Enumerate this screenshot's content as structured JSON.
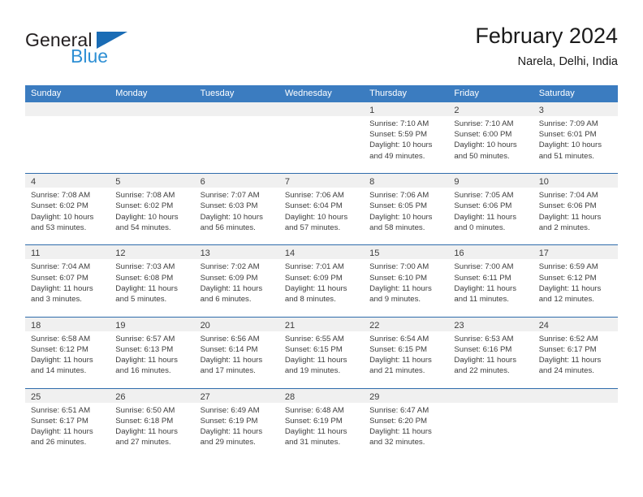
{
  "brand": {
    "name_part1": "General",
    "name_part2": "Blue",
    "flag_icon": "triangle-flag-icon",
    "color_dark": "#231f20",
    "color_blue": "#2e8fd4"
  },
  "header": {
    "title": "February 2024",
    "subtitle": "Narela, Delhi, India"
  },
  "theme": {
    "header_bg": "#3b7cc0",
    "row_border": "#2f6cab",
    "daynum_bg": "#f0f0f0",
    "text": "#3d3d3d"
  },
  "weekdays": [
    "Sunday",
    "Monday",
    "Tuesday",
    "Wednesday",
    "Thursday",
    "Friday",
    "Saturday"
  ],
  "weeks": [
    [
      {
        "day": "",
        "sunrise": "",
        "sunset": "",
        "daylight_line1": "",
        "daylight_line2": ""
      },
      {
        "day": "",
        "sunrise": "",
        "sunset": "",
        "daylight_line1": "",
        "daylight_line2": ""
      },
      {
        "day": "",
        "sunrise": "",
        "sunset": "",
        "daylight_line1": "",
        "daylight_line2": ""
      },
      {
        "day": "",
        "sunrise": "",
        "sunset": "",
        "daylight_line1": "",
        "daylight_line2": ""
      },
      {
        "day": "1",
        "sunrise": "Sunrise: 7:10 AM",
        "sunset": "Sunset: 5:59 PM",
        "daylight_line1": "Daylight: 10 hours",
        "daylight_line2": "and 49 minutes."
      },
      {
        "day": "2",
        "sunrise": "Sunrise: 7:10 AM",
        "sunset": "Sunset: 6:00 PM",
        "daylight_line1": "Daylight: 10 hours",
        "daylight_line2": "and 50 minutes."
      },
      {
        "day": "3",
        "sunrise": "Sunrise: 7:09 AM",
        "sunset": "Sunset: 6:01 PM",
        "daylight_line1": "Daylight: 10 hours",
        "daylight_line2": "and 51 minutes."
      }
    ],
    [
      {
        "day": "4",
        "sunrise": "Sunrise: 7:08 AM",
        "sunset": "Sunset: 6:02 PM",
        "daylight_line1": "Daylight: 10 hours",
        "daylight_line2": "and 53 minutes."
      },
      {
        "day": "5",
        "sunrise": "Sunrise: 7:08 AM",
        "sunset": "Sunset: 6:02 PM",
        "daylight_line1": "Daylight: 10 hours",
        "daylight_line2": "and 54 minutes."
      },
      {
        "day": "6",
        "sunrise": "Sunrise: 7:07 AM",
        "sunset": "Sunset: 6:03 PM",
        "daylight_line1": "Daylight: 10 hours",
        "daylight_line2": "and 56 minutes."
      },
      {
        "day": "7",
        "sunrise": "Sunrise: 7:06 AM",
        "sunset": "Sunset: 6:04 PM",
        "daylight_line1": "Daylight: 10 hours",
        "daylight_line2": "and 57 minutes."
      },
      {
        "day": "8",
        "sunrise": "Sunrise: 7:06 AM",
        "sunset": "Sunset: 6:05 PM",
        "daylight_line1": "Daylight: 10 hours",
        "daylight_line2": "and 58 minutes."
      },
      {
        "day": "9",
        "sunrise": "Sunrise: 7:05 AM",
        "sunset": "Sunset: 6:06 PM",
        "daylight_line1": "Daylight: 11 hours",
        "daylight_line2": "and 0 minutes."
      },
      {
        "day": "10",
        "sunrise": "Sunrise: 7:04 AM",
        "sunset": "Sunset: 6:06 PM",
        "daylight_line1": "Daylight: 11 hours",
        "daylight_line2": "and 2 minutes."
      }
    ],
    [
      {
        "day": "11",
        "sunrise": "Sunrise: 7:04 AM",
        "sunset": "Sunset: 6:07 PM",
        "daylight_line1": "Daylight: 11 hours",
        "daylight_line2": "and 3 minutes."
      },
      {
        "day": "12",
        "sunrise": "Sunrise: 7:03 AM",
        "sunset": "Sunset: 6:08 PM",
        "daylight_line1": "Daylight: 11 hours",
        "daylight_line2": "and 5 minutes."
      },
      {
        "day": "13",
        "sunrise": "Sunrise: 7:02 AM",
        "sunset": "Sunset: 6:09 PM",
        "daylight_line1": "Daylight: 11 hours",
        "daylight_line2": "and 6 minutes."
      },
      {
        "day": "14",
        "sunrise": "Sunrise: 7:01 AM",
        "sunset": "Sunset: 6:09 PM",
        "daylight_line1": "Daylight: 11 hours",
        "daylight_line2": "and 8 minutes."
      },
      {
        "day": "15",
        "sunrise": "Sunrise: 7:00 AM",
        "sunset": "Sunset: 6:10 PM",
        "daylight_line1": "Daylight: 11 hours",
        "daylight_line2": "and 9 minutes."
      },
      {
        "day": "16",
        "sunrise": "Sunrise: 7:00 AM",
        "sunset": "Sunset: 6:11 PM",
        "daylight_line1": "Daylight: 11 hours",
        "daylight_line2": "and 11 minutes."
      },
      {
        "day": "17",
        "sunrise": "Sunrise: 6:59 AM",
        "sunset": "Sunset: 6:12 PM",
        "daylight_line1": "Daylight: 11 hours",
        "daylight_line2": "and 12 minutes."
      }
    ],
    [
      {
        "day": "18",
        "sunrise": "Sunrise: 6:58 AM",
        "sunset": "Sunset: 6:12 PM",
        "daylight_line1": "Daylight: 11 hours",
        "daylight_line2": "and 14 minutes."
      },
      {
        "day": "19",
        "sunrise": "Sunrise: 6:57 AM",
        "sunset": "Sunset: 6:13 PM",
        "daylight_line1": "Daylight: 11 hours",
        "daylight_line2": "and 16 minutes."
      },
      {
        "day": "20",
        "sunrise": "Sunrise: 6:56 AM",
        "sunset": "Sunset: 6:14 PM",
        "daylight_line1": "Daylight: 11 hours",
        "daylight_line2": "and 17 minutes."
      },
      {
        "day": "21",
        "sunrise": "Sunrise: 6:55 AM",
        "sunset": "Sunset: 6:15 PM",
        "daylight_line1": "Daylight: 11 hours",
        "daylight_line2": "and 19 minutes."
      },
      {
        "day": "22",
        "sunrise": "Sunrise: 6:54 AM",
        "sunset": "Sunset: 6:15 PM",
        "daylight_line1": "Daylight: 11 hours",
        "daylight_line2": "and 21 minutes."
      },
      {
        "day": "23",
        "sunrise": "Sunrise: 6:53 AM",
        "sunset": "Sunset: 6:16 PM",
        "daylight_line1": "Daylight: 11 hours",
        "daylight_line2": "and 22 minutes."
      },
      {
        "day": "24",
        "sunrise": "Sunrise: 6:52 AM",
        "sunset": "Sunset: 6:17 PM",
        "daylight_line1": "Daylight: 11 hours",
        "daylight_line2": "and 24 minutes."
      }
    ],
    [
      {
        "day": "25",
        "sunrise": "Sunrise: 6:51 AM",
        "sunset": "Sunset: 6:17 PM",
        "daylight_line1": "Daylight: 11 hours",
        "daylight_line2": "and 26 minutes."
      },
      {
        "day": "26",
        "sunrise": "Sunrise: 6:50 AM",
        "sunset": "Sunset: 6:18 PM",
        "daylight_line1": "Daylight: 11 hours",
        "daylight_line2": "and 27 minutes."
      },
      {
        "day": "27",
        "sunrise": "Sunrise: 6:49 AM",
        "sunset": "Sunset: 6:19 PM",
        "daylight_line1": "Daylight: 11 hours",
        "daylight_line2": "and 29 minutes."
      },
      {
        "day": "28",
        "sunrise": "Sunrise: 6:48 AM",
        "sunset": "Sunset: 6:19 PM",
        "daylight_line1": "Daylight: 11 hours",
        "daylight_line2": "and 31 minutes."
      },
      {
        "day": "29",
        "sunrise": "Sunrise: 6:47 AM",
        "sunset": "Sunset: 6:20 PM",
        "daylight_line1": "Daylight: 11 hours",
        "daylight_line2": "and 32 minutes."
      },
      {
        "day": "",
        "sunrise": "",
        "sunset": "",
        "daylight_line1": "",
        "daylight_line2": ""
      },
      {
        "day": "",
        "sunrise": "",
        "sunset": "",
        "daylight_line1": "",
        "daylight_line2": ""
      }
    ]
  ]
}
